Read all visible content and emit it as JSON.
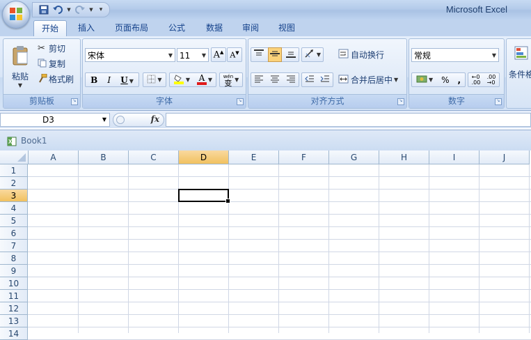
{
  "app": {
    "title": "Microsoft Excel"
  },
  "qat": {
    "icons": [
      "save-icon",
      "undo-icon",
      "redo-icon",
      "customize-icon"
    ]
  },
  "tabs": [
    "开始",
    "插入",
    "页面布局",
    "公式",
    "数据",
    "审阅",
    "视图"
  ],
  "active_tab": "开始",
  "ribbon": {
    "clipboard": {
      "label": "剪贴板",
      "paste": "粘贴",
      "cut": "剪切",
      "copy": "复制",
      "format_painter": "格式刷"
    },
    "font": {
      "label": "字体",
      "font_name": "宋体",
      "font_size": "11",
      "bold": "B",
      "italic": "I",
      "underline": "U",
      "phonetic": "wén",
      "phonetic_char": "变"
    },
    "alignment": {
      "label": "对齐方式",
      "wrap_text": "自动换行",
      "merge_center": "合并后居中"
    },
    "number": {
      "label": "数字",
      "format": "常规",
      "percent": "%",
      "comma": ","
    },
    "styles": {
      "conditional_format": "条件格"
    }
  },
  "formula_bar": {
    "name_box": "D3",
    "fx": "fx",
    "formula": ""
  },
  "workbook": {
    "title": "Book1"
  },
  "grid": {
    "columns": [
      "A",
      "B",
      "C",
      "D",
      "E",
      "F",
      "G",
      "H",
      "I",
      "J"
    ],
    "rows": [
      "1",
      "2",
      "3",
      "4",
      "5",
      "6",
      "7",
      "8",
      "9",
      "10",
      "11",
      "12",
      "13",
      "14"
    ],
    "selected_cell": "D3"
  },
  "colors": {
    "accent": "#15428b",
    "selected_header": "#f1c15f",
    "grid_line": "#d0d7e5"
  }
}
